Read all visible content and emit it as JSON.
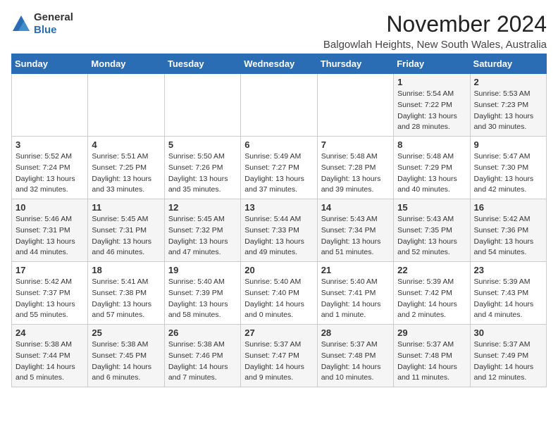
{
  "logo": {
    "general": "General",
    "blue": "Blue"
  },
  "header": {
    "month": "November 2024",
    "location": "Balgowlah Heights, New South Wales, Australia"
  },
  "days_of_week": [
    "Sunday",
    "Monday",
    "Tuesday",
    "Wednesday",
    "Thursday",
    "Friday",
    "Saturday"
  ],
  "weeks": [
    [
      {
        "day": "",
        "info": ""
      },
      {
        "day": "",
        "info": ""
      },
      {
        "day": "",
        "info": ""
      },
      {
        "day": "",
        "info": ""
      },
      {
        "day": "",
        "info": ""
      },
      {
        "day": "1",
        "info": "Sunrise: 5:54 AM\nSunset: 7:22 PM\nDaylight: 13 hours\nand 28 minutes."
      },
      {
        "day": "2",
        "info": "Sunrise: 5:53 AM\nSunset: 7:23 PM\nDaylight: 13 hours\nand 30 minutes."
      }
    ],
    [
      {
        "day": "3",
        "info": "Sunrise: 5:52 AM\nSunset: 7:24 PM\nDaylight: 13 hours\nand 32 minutes."
      },
      {
        "day": "4",
        "info": "Sunrise: 5:51 AM\nSunset: 7:25 PM\nDaylight: 13 hours\nand 33 minutes."
      },
      {
        "day": "5",
        "info": "Sunrise: 5:50 AM\nSunset: 7:26 PM\nDaylight: 13 hours\nand 35 minutes."
      },
      {
        "day": "6",
        "info": "Sunrise: 5:49 AM\nSunset: 7:27 PM\nDaylight: 13 hours\nand 37 minutes."
      },
      {
        "day": "7",
        "info": "Sunrise: 5:48 AM\nSunset: 7:28 PM\nDaylight: 13 hours\nand 39 minutes."
      },
      {
        "day": "8",
        "info": "Sunrise: 5:48 AM\nSunset: 7:29 PM\nDaylight: 13 hours\nand 40 minutes."
      },
      {
        "day": "9",
        "info": "Sunrise: 5:47 AM\nSunset: 7:30 PM\nDaylight: 13 hours\nand 42 minutes."
      }
    ],
    [
      {
        "day": "10",
        "info": "Sunrise: 5:46 AM\nSunset: 7:31 PM\nDaylight: 13 hours\nand 44 minutes."
      },
      {
        "day": "11",
        "info": "Sunrise: 5:45 AM\nSunset: 7:31 PM\nDaylight: 13 hours\nand 46 minutes."
      },
      {
        "day": "12",
        "info": "Sunrise: 5:45 AM\nSunset: 7:32 PM\nDaylight: 13 hours\nand 47 minutes."
      },
      {
        "day": "13",
        "info": "Sunrise: 5:44 AM\nSunset: 7:33 PM\nDaylight: 13 hours\nand 49 minutes."
      },
      {
        "day": "14",
        "info": "Sunrise: 5:43 AM\nSunset: 7:34 PM\nDaylight: 13 hours\nand 51 minutes."
      },
      {
        "day": "15",
        "info": "Sunrise: 5:43 AM\nSunset: 7:35 PM\nDaylight: 13 hours\nand 52 minutes."
      },
      {
        "day": "16",
        "info": "Sunrise: 5:42 AM\nSunset: 7:36 PM\nDaylight: 13 hours\nand 54 minutes."
      }
    ],
    [
      {
        "day": "17",
        "info": "Sunrise: 5:42 AM\nSunset: 7:37 PM\nDaylight: 13 hours\nand 55 minutes."
      },
      {
        "day": "18",
        "info": "Sunrise: 5:41 AM\nSunset: 7:38 PM\nDaylight: 13 hours\nand 57 minutes."
      },
      {
        "day": "19",
        "info": "Sunrise: 5:40 AM\nSunset: 7:39 PM\nDaylight: 13 hours\nand 58 minutes."
      },
      {
        "day": "20",
        "info": "Sunrise: 5:40 AM\nSunset: 7:40 PM\nDaylight: 14 hours\nand 0 minutes."
      },
      {
        "day": "21",
        "info": "Sunrise: 5:40 AM\nSunset: 7:41 PM\nDaylight: 14 hours\nand 1 minute."
      },
      {
        "day": "22",
        "info": "Sunrise: 5:39 AM\nSunset: 7:42 PM\nDaylight: 14 hours\nand 2 minutes."
      },
      {
        "day": "23",
        "info": "Sunrise: 5:39 AM\nSunset: 7:43 PM\nDaylight: 14 hours\nand 4 minutes."
      }
    ],
    [
      {
        "day": "24",
        "info": "Sunrise: 5:38 AM\nSunset: 7:44 PM\nDaylight: 14 hours\nand 5 minutes."
      },
      {
        "day": "25",
        "info": "Sunrise: 5:38 AM\nSunset: 7:45 PM\nDaylight: 14 hours\nand 6 minutes."
      },
      {
        "day": "26",
        "info": "Sunrise: 5:38 AM\nSunset: 7:46 PM\nDaylight: 14 hours\nand 7 minutes."
      },
      {
        "day": "27",
        "info": "Sunrise: 5:37 AM\nSunset: 7:47 PM\nDaylight: 14 hours\nand 9 minutes."
      },
      {
        "day": "28",
        "info": "Sunrise: 5:37 AM\nSunset: 7:48 PM\nDaylight: 14 hours\nand 10 minutes."
      },
      {
        "day": "29",
        "info": "Sunrise: 5:37 AM\nSunset: 7:48 PM\nDaylight: 14 hours\nand 11 minutes."
      },
      {
        "day": "30",
        "info": "Sunrise: 5:37 AM\nSunset: 7:49 PM\nDaylight: 14 hours\nand 12 minutes."
      }
    ]
  ]
}
